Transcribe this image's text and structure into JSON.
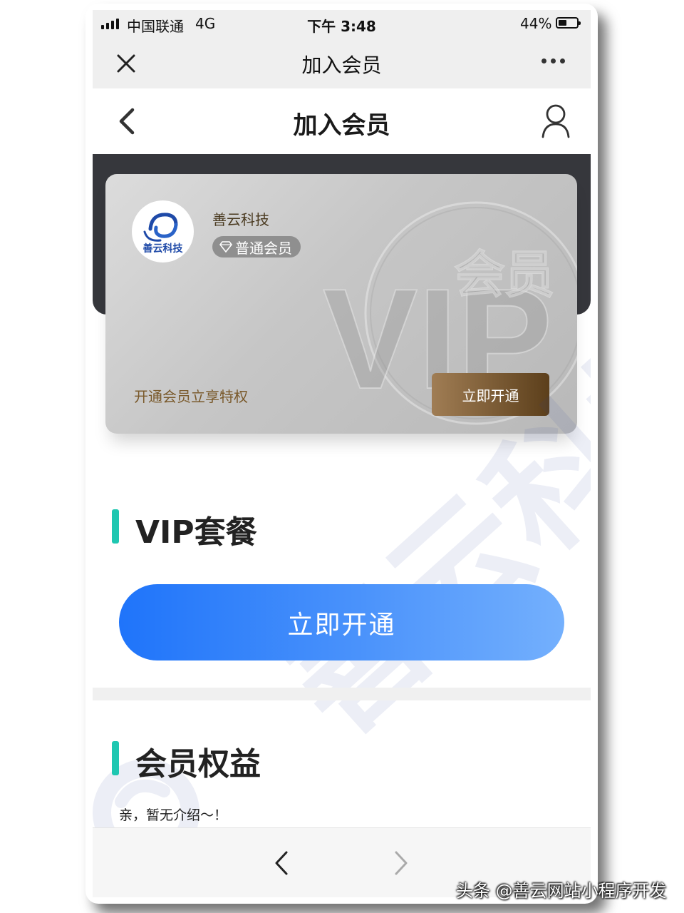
{
  "status_bar": {
    "carrier": "中国联通",
    "network": "4G",
    "time": "下午 3:48",
    "battery_percent": "44%",
    "battery_level": 0.44
  },
  "wechat_nav": {
    "title": "加入会员",
    "close_icon": "close-icon",
    "more_icon": "more-dots-icon"
  },
  "page_header": {
    "title": "加入会员",
    "back_icon": "chevron-left-icon",
    "user_icon": "user-icon"
  },
  "member_card": {
    "logo_text": "善云科技",
    "company": "善云科技",
    "level_icon": "diamond-icon",
    "level": "普通会员",
    "tagline": "开通会员立享特权",
    "open_button": "立即开通",
    "watermark_vip": "VIP",
    "watermark_cn": "会员"
  },
  "vip_section": {
    "title": "VIP套餐",
    "open_button": "立即开通"
  },
  "benefits_section": {
    "title": "会员权益",
    "empty_text": "亲，暂无介绍～！"
  },
  "bottom_nav": {
    "back_icon": "chevron-left-icon",
    "forward_icon": "chevron-right-icon"
  },
  "watermark": {
    "text": "善云科技"
  },
  "credit": "头条 @善云网站小程序开发",
  "colors": {
    "accent_teal": "#1fc7b1",
    "button_blue": "#1f74fa",
    "card_button_brown": "#7a5a30",
    "dark_band": "#36373c"
  }
}
